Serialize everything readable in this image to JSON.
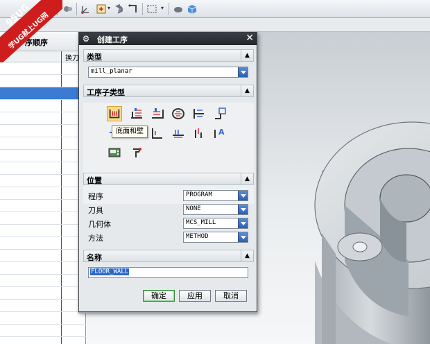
{
  "watermark": {
    "line1": "9SUG",
    "line2": "学UG就上UG网"
  },
  "navigator": {
    "title": "序顺序",
    "column2": "换刀"
  },
  "dialog": {
    "title": "创建工序",
    "type_section": "类型",
    "type_value": "mill_planar",
    "subtype_section": "工序子类型",
    "tooltip": "底面和壁",
    "location_section": "位置",
    "program_label": "程序",
    "program_value": "PROGRAM",
    "tool_label": "刀具",
    "tool_value": "NONE",
    "geometry_label": "几何体",
    "geometry_value": "MCS_MILL",
    "method_label": "方法",
    "method_value": "METHOD",
    "name_section": "名称",
    "name_value": "FLOOR_WALL",
    "ok_label": "确定",
    "apply_label": "应用",
    "cancel_label": "取消"
  },
  "colors": {
    "selection": "#3b7bd4",
    "title_bar": "#23272b",
    "ok_border": "#3a8a3a"
  }
}
